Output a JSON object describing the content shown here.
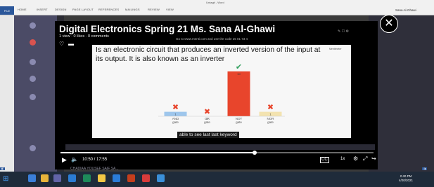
{
  "word": {
    "doc_title": "Untagit - Word",
    "user": "Sana Al-Ghawi",
    "tabs": [
      "FILE",
      "HOME",
      "INSERT",
      "DESIGN",
      "PAGE LAYOUT",
      "REFERENCES",
      "MAILINGS",
      "REVIEW",
      "VIEW"
    ]
  },
  "video": {
    "title": "Digital Electronics Spring 21 Ms. Sana Al-Ghawi",
    "meta": "1 view · 0 likes · 0 comments",
    "share_instruction": "Go to www.menti.com and use the code 25 01 73 4",
    "caption": "able to see last last keyword",
    "time": "10:50 / 17:55",
    "speed": "1x",
    "progress": 0.62
  },
  "slide": {
    "text": "Is an electronic circuit that produces an inverted version of the input at its output.  It is also known as an inverter",
    "logo": "Mentimeter"
  },
  "chart_data": {
    "type": "bar",
    "categories": [
      "AND gate",
      "OR gate",
      "NOT gate",
      "NOR gate"
    ],
    "values": [
      1,
      0,
      10,
      1
    ],
    "marks": [
      "cross",
      "cross",
      "check",
      "cross"
    ],
    "colors": [
      "#9ec6ec",
      "#e85a4f",
      "#e8452c",
      "#f3e3b0"
    ]
  },
  "controls": {
    "play_icon": "play-icon",
    "volume_icon": "volume-icon",
    "settings_icon": "gear-icon",
    "fullscreen_icon": "fullscreen-icon"
  },
  "background": {
    "participant_text": "CHADIAA YOUSEF SAIF SA..."
  },
  "taskbar": {
    "time": "2:40 PM",
    "date": "4/20/2021"
  }
}
